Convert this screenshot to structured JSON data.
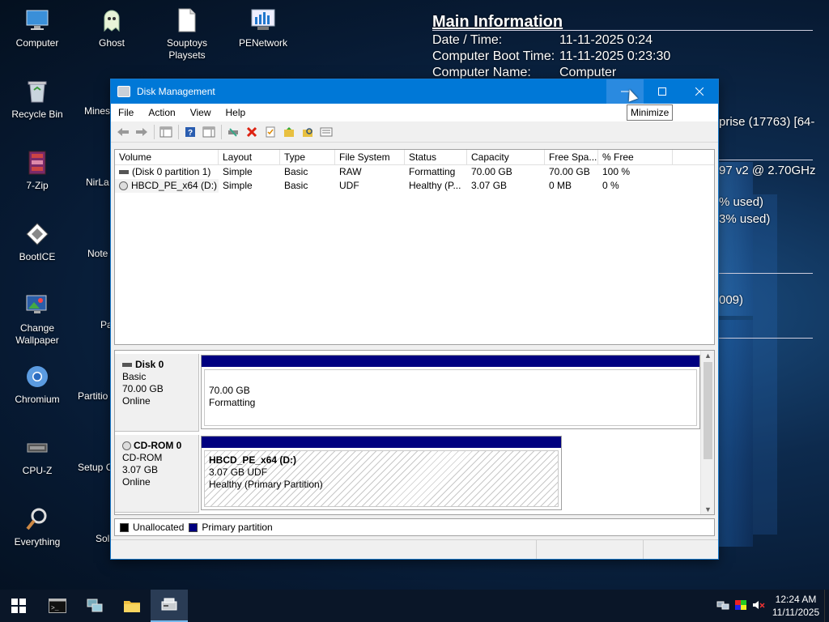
{
  "desktop": {
    "icons": [
      {
        "label": "Computer",
        "icon": "computer-icon"
      },
      {
        "label": "Ghost",
        "icon": "ghost-icon"
      },
      {
        "label": "Souptoys Playsets",
        "icon": "file-icon"
      },
      {
        "label": "PENetwork",
        "icon": "network-icon"
      },
      {
        "label": "Recycle Bin",
        "icon": "recycle-bin-icon"
      },
      {
        "label": "7-Zip",
        "icon": "7zip-icon"
      },
      {
        "label": "BootICE",
        "icon": "bootice-icon"
      },
      {
        "label": "Change Wallpaper",
        "icon": "wallpaper-icon"
      },
      {
        "label": "Chromium",
        "icon": "chromium-icon"
      },
      {
        "label": "CPU-Z",
        "icon": "cpu-icon"
      },
      {
        "label": "Everything",
        "icon": "magnifier-icon"
      }
    ],
    "partial_icons": [
      "Mines",
      "NirLa",
      "Note",
      "Pa",
      "Partitio",
      "Setup C",
      "Sol"
    ]
  },
  "bginfo": {
    "title": "Main Information",
    "rows": [
      {
        "label": "Date / Time:",
        "value": "11-11-2025 0:24"
      },
      {
        "label": "Computer Boot Time:",
        "value": "11-11-2025 0:23:30"
      },
      {
        "label": "Computer Name:",
        "value": "Computer"
      }
    ],
    "fragments": [
      "prise (17763) [64-",
      "97 v2 @ 2.70GHz",
      "% used)",
      "3% used)",
      "009)"
    ]
  },
  "window": {
    "title": "Disk Management",
    "menu": [
      "File",
      "Action",
      "View",
      "Help"
    ],
    "columns": [
      "Volume",
      "Layout",
      "Type",
      "File System",
      "Status",
      "Capacity",
      "Free Spa...",
      "% Free"
    ],
    "volumes": [
      [
        "(Disk 0 partition 1)",
        "Simple",
        "Basic",
        "RAW",
        "Formatting",
        "70.00 GB",
        "70.00 GB",
        "100 %"
      ],
      [
        "HBCD_PE_x64 (D:)",
        "Simple",
        "Basic",
        "UDF",
        "Healthy (P...",
        "3.07 GB",
        "0 MB",
        "0 %"
      ]
    ],
    "disks": [
      {
        "name": "Disk 0",
        "type": "Basic",
        "size": "70.00 GB",
        "state": "Online",
        "partition": {
          "title": "",
          "line1": "70.00 GB",
          "line2": "Formatting"
        }
      },
      {
        "name": "CD-ROM 0",
        "type": "CD-ROM",
        "size": "3.07 GB",
        "state": "Online",
        "partition": {
          "title": "HBCD_PE_x64  (D:)",
          "line1": "3.07 GB UDF",
          "line2": "Healthy (Primary Partition)"
        }
      }
    ],
    "legend": [
      {
        "label": "Unallocated",
        "color": "#000000"
      },
      {
        "label": "Primary partition",
        "color": "#000080"
      }
    ],
    "tooltip": "Minimize"
  },
  "taskbar": {
    "time": "12:24 AM",
    "date": "11/11/2025"
  },
  "colors": {
    "titlebar": "#0078d7",
    "partition_bar": "#000080"
  }
}
